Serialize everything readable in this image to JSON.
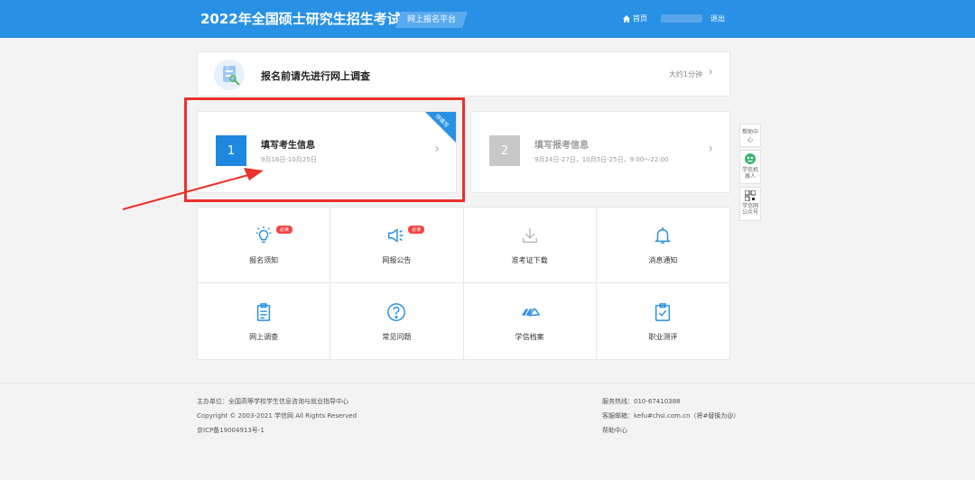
{
  "header": {
    "title": "2022年全国硕士研究生招生考试",
    "platform": "网上报名平台",
    "home": "首页",
    "logout": "退出"
  },
  "survey": {
    "title": "报名前请先进行网上调查",
    "time": "大约1分钟"
  },
  "steps": [
    {
      "num": "1",
      "title": "填写考生信息",
      "date": "9月16日-10月25日",
      "ribbon": "待填写"
    },
    {
      "num": "2",
      "title": "填写报考信息",
      "date": "9月24日-27日，10月5日-25日，9:00～22:00"
    }
  ],
  "tiles": [
    {
      "label": "报名须知",
      "badge": "必读",
      "icon": "lightbulb-icon"
    },
    {
      "label": "网报公告",
      "badge": "必读",
      "icon": "megaphone-icon"
    },
    {
      "label": "准考证下载",
      "icon": "download-icon"
    },
    {
      "label": "消息通知",
      "icon": "bell-icon"
    },
    {
      "label": "网上调查",
      "icon": "clipboard-icon"
    },
    {
      "label": "常见问题",
      "icon": "question-icon"
    },
    {
      "label": "学信档案",
      "icon": "hand-icon"
    },
    {
      "label": "职业测评",
      "icon": "check-clipboard-icon"
    }
  ],
  "side_tools": {
    "help": "帮助中心",
    "robot": "学信机器人",
    "qr": "学信网公众号"
  },
  "footer": {
    "sponsor": "主办单位：全国高等学校学生信息咨询与就业指导中心",
    "copyright": "Copyright © 2003-2021 学信网 All Rights Reserved",
    "icp": "京ICP备19004913号-1",
    "hotline": "服务热线：010-67410388",
    "email": "客服邮箱：kefu#chsi.com.cn（将#替换为@）",
    "help": "帮助中心"
  },
  "colors": {
    "primary": "#2991e5",
    "highlight": "#e8322b",
    "badge": "#f04646"
  }
}
